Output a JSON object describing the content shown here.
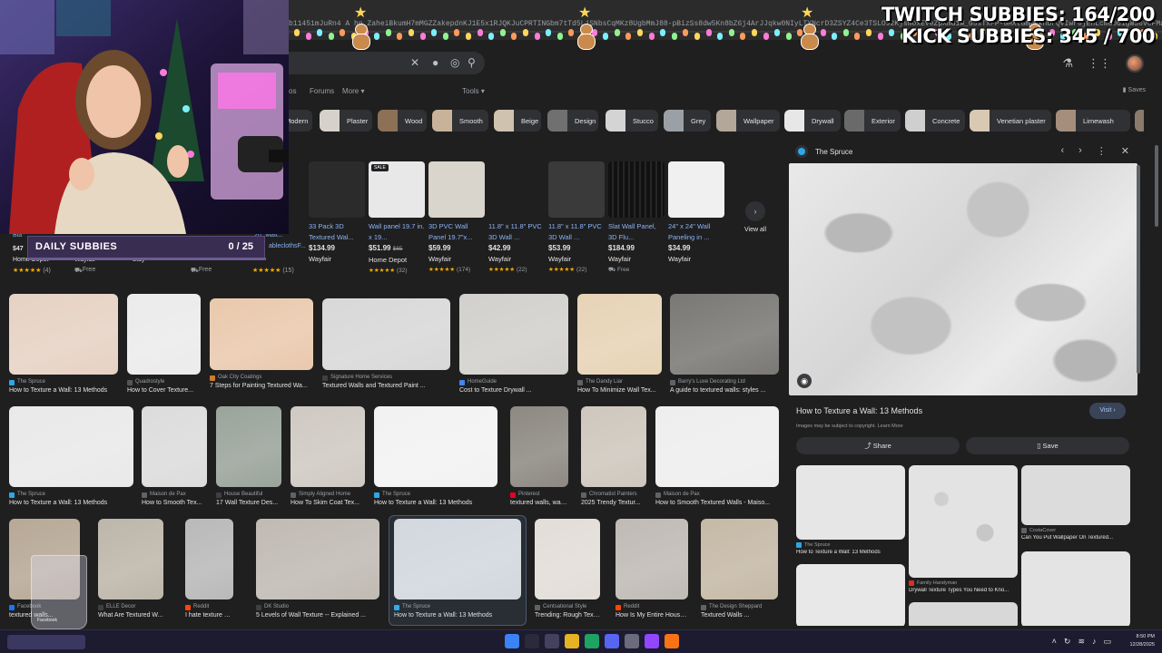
{
  "overlay": {
    "twitch_subs": "TWITCH SUBBIES: 164/200",
    "kick_subs": "KICK SUBBIES: 345 / 700",
    "daily_label": "DAILY SUBBIES",
    "daily_count": "0 / 25"
  },
  "browser": {
    "url_text": "b11451mJuRn4 A hn ZaheiBkumH7mMGZZakepdnKJ1E5x1RJQKJuCPRTINGbm7tTd5LjSNbsCqMKz8UgbMmJ88-pBizSs8dw5Kn8bZ6j4ArJJqkw0NIyLTYNcrD3ZSYZ4Ce3TSLOJ2KjsmoxEVeZpXmd1W_G5sTxFP-GHXtGmmEknbrQVIwr0jEhLcmG0d1gWS6vcFMa1qdDZKs5KJWvrcKbrPKj0LRqyP1h1Lfq5z8eCDXZ1tFqLs9_FQ4KrpYuG2ZCYGmlUYBo-gm0FDRYQkb5Mct3IIqCrJNDqSn"
  },
  "search": {
    "nav": [
      "os",
      "Forums",
      "More ▾",
      "Tools ▾"
    ],
    "saves": "Saves"
  },
  "chips": [
    "Modern",
    "Plaster",
    "Wood",
    "Smooth",
    "Beige",
    "Design",
    "Stucco",
    "Grey",
    "Wallpaper",
    "Drywall",
    "Exterior",
    "Concrete",
    "Venetian plaster",
    "Limewash"
  ],
  "shopping": [
    {
      "name": "33 Pack 3D Textured Wal...",
      "price": "$134.99",
      "store": "Wayfair",
      "rating": "★★★★★",
      "reviews": "",
      "color": "#2b2b2b"
    },
    {
      "name": "Wall panel 19.7 in. x 19...",
      "price": "$51.99",
      "old_price": "$65",
      "store": "Home Depot",
      "rating": "★★★★★",
      "reviews": "(32)",
      "sale": "SALE",
      "color": "#e8e8e8"
    },
    {
      "name": "3D PVC Wall Panel 19.7\"x...",
      "price": "$59.99",
      "store": "Wayfair",
      "rating": "★★★★★",
      "reviews": "(174)",
      "color": "#d9d4cc"
    },
    {
      "name": "11.8\" x 11.8\" PVC 3D Wall ...",
      "price": "$42.99",
      "store": "Wayfair",
      "rating": "★★★★★",
      "reviews": "(22)",
      "color": "#1f1f1f"
    },
    {
      "name": "11.8\" x 11.8\" PVC 3D Wall ...",
      "price": "$53.99",
      "store": "Wayfair",
      "rating": "★★★★★",
      "reviews": "(22)",
      "color": "#3a3a3a"
    },
    {
      "name": "Slat Wall Panel, 3D Flu...",
      "price": "$184.99",
      "store": "Wayfair",
      "shipping": "Free",
      "color": "#161616"
    },
    {
      "name": "24\" x 24\" Wall Paneling in ...",
      "price": "$34.99",
      "store": "Wayfair",
      "color": "#f0f0f0"
    }
  ],
  "shopping_view_all": "View all",
  "left_sliver": {
    "name1": "Bla",
    "name2": "20\" Matt...",
    "name3": "ableclothsF...",
    "price1": "$47",
    "store1": "Home Depot",
    "store2": "Wayfair",
    "store3": "Etsy",
    "free1": "Free",
    "free2": "Free",
    "rev": "(4)",
    "rev2": "(15)"
  },
  "grid": [
    {
      "source": "The Spruce",
      "title": "How to Texture a Wall: 13 Methods",
      "color": "#e6d2c4",
      "icon": "#2da7e8"
    },
    {
      "source": "Quadrostyle",
      "title": "How to Cover Texture...",
      "color": "#ebebeb",
      "icon": "#555555"
    },
    {
      "source": "Oak City Coatings",
      "title": "7 Steps for Painting Textured Wa...",
      "color": "#e9c9ad",
      "icon": "#d17a2a"
    },
    {
      "source": "Signature Home Services",
      "title": "Textured Walls and Textured Paint ...",
      "color": "#d8d8d8",
      "icon": "#3c4043"
    },
    {
      "source": "HomeGuide",
      "title": "Cost to Texture Drywall ...",
      "color": "#d2d0cc",
      "icon": "#4285f4"
    },
    {
      "source": "The Dandy Liar",
      "title": "How To Minimize Wall Tex...",
      "color": "#e7d3b6",
      "icon": "#5f6368"
    },
    {
      "source": "Barry's Luxe Decorating Ltd",
      "title": "A guide to textured walls: styles ...",
      "color": "#7a7875",
      "icon": "#5f6368"
    },
    {
      "source": "The Spruce",
      "title": "How to Texture a Wall: 13 Methods",
      "color": "#e9e9e9",
      "icon": "#2da7e8"
    },
    {
      "source": "Maison de Pax",
      "title": "How to Smooth Tex...",
      "color": "#dcdcdc",
      "icon": "#5f6368"
    },
    {
      "source": "House Beautiful",
      "title": "17 Wall Texture Des...",
      "color": "#9aa49b",
      "icon": "#3c4043"
    },
    {
      "source": "Simply Aligned Home",
      "title": "How To Skim Coat Tex...",
      "color": "#cfc9c2",
      "icon": "#5f6368"
    },
    {
      "source": "The Spruce",
      "title": "How to Texture a Wall: 13 Methods",
      "color": "#f2f2f2",
      "icon": "#2da7e8"
    },
    {
      "source": "Pinterest",
      "title": "textured walls, wall ...",
      "color": "#8d8982",
      "icon": "#e60023"
    },
    {
      "source": "Chromatist Painters",
      "title": "2025 Trendy Textur...",
      "color": "#cfc7bd",
      "icon": "#5f6368"
    },
    {
      "source": "Maison de Pax",
      "title": "How to Smooth Textured Walls - Maiso...",
      "color": "#eeeeee",
      "icon": "#5f6368"
    },
    {
      "source": "Facebook",
      "title": "textured walls...",
      "color": "#b7a896",
      "icon": "#1877f2"
    },
    {
      "source": "ELLE Decor",
      "title": "What Are Textured W...",
      "color": "#bdb6aa",
      "icon": "#3c4043"
    },
    {
      "source": "Reddit",
      "title": "I hate texture walls....",
      "color": "#b9b9b9",
      "icon": "#ff4500"
    },
    {
      "source": "DK Studio",
      "title": "5 Levels of Wall Texture -- Explained ...",
      "color": "#c0bab3",
      "icon": "#3c4043"
    },
    {
      "source": "The Spruce",
      "title": "How to Texture a Wall: 13 Methods",
      "color": "#dcdcdc",
      "icon": "#2da7e8"
    },
    {
      "source": "Centsational Style",
      "title": "Trending: Rough Text...",
      "color": "#e2ddd8",
      "icon": "#5f6368"
    },
    {
      "source": "Reddit",
      "title": "How Is My Entire House...",
      "color": "#bfbab4",
      "icon": "#ff4500"
    },
    {
      "source": "The Design Sheppard",
      "title": "Textured Walls ...",
      "color": "#c5b9a6",
      "icon": "#5f6368"
    }
  ],
  "panel": {
    "source": "The Spruce",
    "title": "How to Texture a Wall: 13 Methods",
    "copyright": "Images may be subject to copyright. Learn More",
    "visit": "Visit ›",
    "share": "Share",
    "save": "Save",
    "related": [
      {
        "source": "The Spruce",
        "title": "How to Texture a Wall: 13 Methods",
        "icon": "#2da7e8"
      },
      {
        "source": "Family Handyman",
        "title": "Drywall Texture Types You Need to Kno...",
        "icon": "#d93025"
      },
      {
        "source": "CostaCover",
        "title": "Can You Put Wallpaper On Textured...",
        "icon": "#5f6368"
      }
    ]
  },
  "taskbar": {
    "time": "8:50 PM",
    "date": "12/28/2025"
  },
  "cup_label": "Facebook"
}
